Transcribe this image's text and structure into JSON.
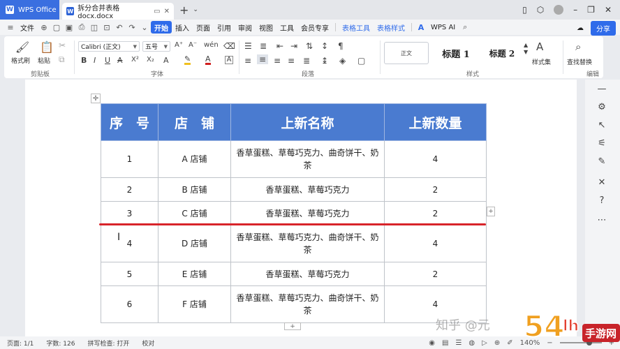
{
  "titlebar": {
    "app_tab": "WPS Office",
    "doc_tab": "拆分合并表格docx.docx"
  },
  "menubar": {
    "file": "文件",
    "items": [
      "开始",
      "插入",
      "页面",
      "引用",
      "审阅",
      "视图",
      "工具",
      "会员专享"
    ],
    "context_items": [
      "表格工具",
      "表格样式"
    ],
    "wps_ai": "WPS AI",
    "share": "分享"
  },
  "ribbon": {
    "format_painter": "格式刷",
    "paste": "粘贴",
    "clipboard_group": "剪贴板",
    "font_name": "Calibri (正文)",
    "font_size": "五号",
    "font_group": "字体",
    "paragraph_group": "段落",
    "style_normal": "正文",
    "style_h1": "标题 1",
    "style_h2": "标题 2",
    "style_set": "样式集",
    "styles_group": "样式",
    "find_replace": "查找替换",
    "editing_group": "编辑"
  },
  "table": {
    "headers": [
      "序　号",
      "店　铺",
      "上新名称",
      "上新数量"
    ],
    "rows": [
      {
        "no": "1",
        "shop": "A 店铺",
        "name": "香草蛋糕、草莓巧克力、曲奇饼干、奶茶",
        "qty": "4"
      },
      {
        "no": "2",
        "shop": "B 店铺",
        "name": "香草蛋糕、草莓巧克力",
        "qty": "2"
      },
      {
        "no": "3",
        "shop": "C 店铺",
        "name": "香草蛋糕、草莓巧克力",
        "qty": "2"
      },
      {
        "no": "4",
        "shop": "D 店铺",
        "name": "香草蛋糕、草莓巧克力、曲奇饼干、奶茶",
        "qty": "4"
      },
      {
        "no": "5",
        "shop": "E 店铺",
        "name": "香草蛋糕、草莓巧克力",
        "qty": "2"
      },
      {
        "no": "6",
        "shop": "F 店铺",
        "name": "香草蛋糕、草莓巧克力、曲奇饼干、奶茶",
        "qty": "4"
      }
    ]
  },
  "statusbar": {
    "page": "页面: 1/1",
    "words": "字数: 126",
    "spell": "拼写检查: 打开",
    "proof": "校对",
    "zoom": "140%"
  },
  "watermark": {
    "zhihu": "知乎 @元",
    "logo_text": "54lh 手游网"
  },
  "colors": {
    "header_blue": "#4a7bd0",
    "accent": "#2f6bea",
    "split_line_red": "#d8242a"
  }
}
